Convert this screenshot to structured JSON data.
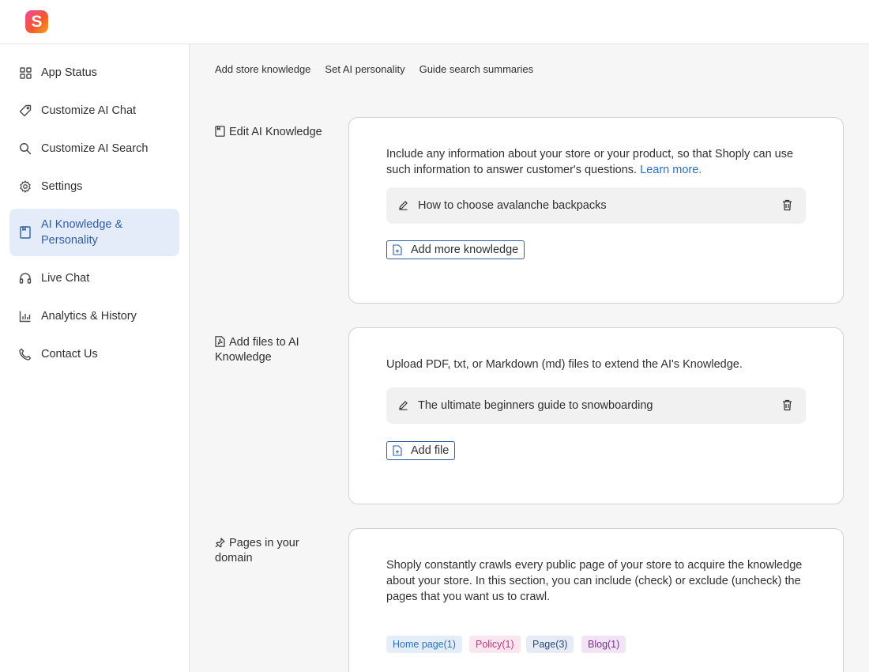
{
  "app": {
    "logo_letter": "S"
  },
  "sidebar": {
    "items": [
      {
        "label": "App Status",
        "icon": "grid-icon"
      },
      {
        "label": "Customize AI Chat",
        "icon": "tag-icon"
      },
      {
        "label": "Customize AI Search",
        "icon": "search-icon"
      },
      {
        "label": "Settings",
        "icon": "gear-icon"
      },
      {
        "label": "AI Knowledge & Personality",
        "icon": "document-icon",
        "active": true
      },
      {
        "label": "Live Chat",
        "icon": "headphones-icon"
      },
      {
        "label": "Analytics & History",
        "icon": "bar-chart-icon"
      },
      {
        "label": "Contact Us",
        "icon": "phone-icon"
      }
    ]
  },
  "tabs": [
    "Add store knowledge",
    "Set AI personality",
    "Guide search summaries"
  ],
  "sections": {
    "knowledge": {
      "label": "Edit AI Knowledge",
      "description": "Include any information about your store or your product, so that Shoply can use such information to answer customer's questions.",
      "learn_more": "Learn more.",
      "item": "How to choose avalanche backpacks",
      "button": "Add more knowledge"
    },
    "files": {
      "label": "Add files to AI Knowledge",
      "description": "Upload PDF, txt, or Markdown (md) files to extend the AI's Knowledge.",
      "item": "The ultimate beginners guide to snowboarding",
      "button": "Add file"
    },
    "pages": {
      "label": "Pages in your domain",
      "description": "Shoply constantly crawls every public page of your store to acquire the knowledge about your store. In this section, you can include (check) or exclude (uncheck) the pages that you want us to crawl.",
      "tags": [
        {
          "label": "Home page(1)",
          "color": "#2c6ecb",
          "bg": "#e4eefb"
        },
        {
          "label": "Policy(1)",
          "color": "#c4367a",
          "bg": "#fbe6f0"
        },
        {
          "label": "Page(3)",
          "color": "#2a4a7a",
          "bg": "#e7ebf5"
        },
        {
          "label": "Blog(1)",
          "color": "#7b2f8e",
          "bg": "#f1e4f5"
        }
      ]
    }
  },
  "colors": {
    "accent": "#2e5ea8",
    "active_bg": "#e4ecfa",
    "link": "#2c6ecb"
  }
}
